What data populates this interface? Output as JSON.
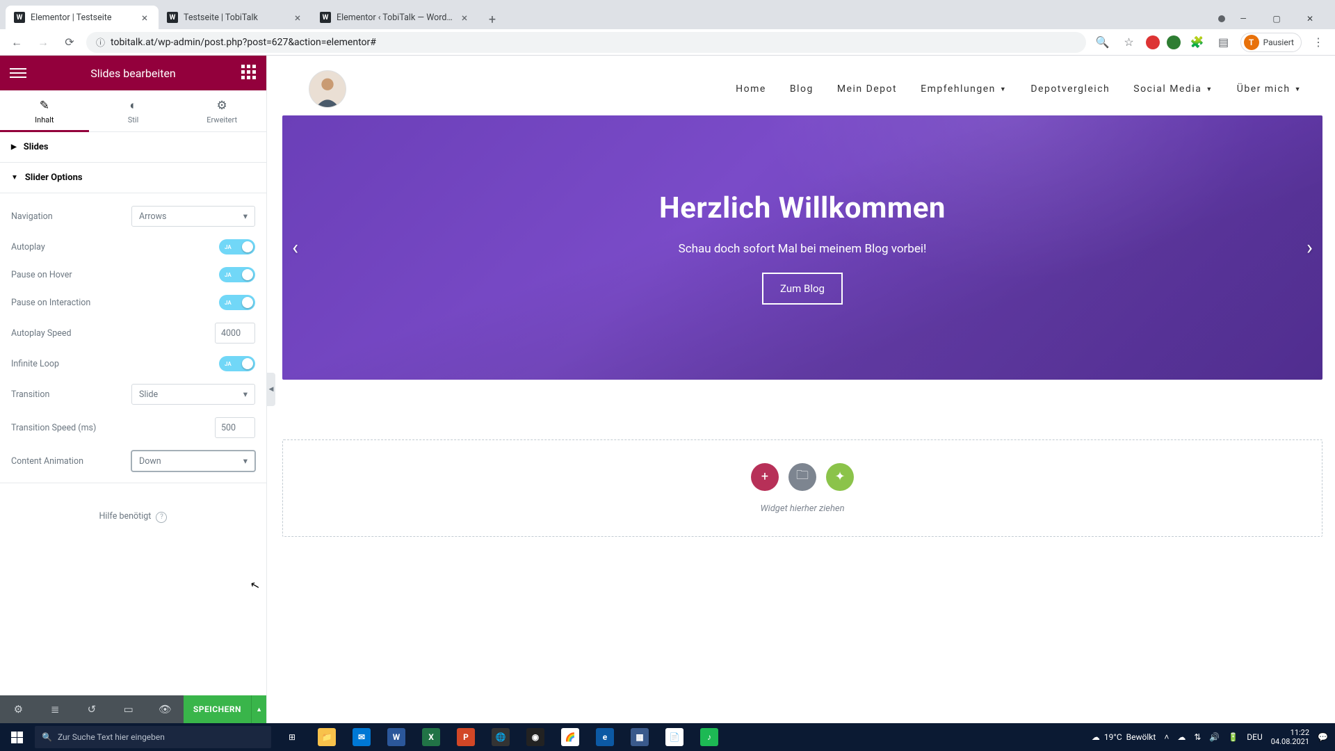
{
  "browser": {
    "tabs": [
      {
        "title": "Elementor | Testseite",
        "active": true
      },
      {
        "title": "Testseite | TobiTalk",
        "active": false
      },
      {
        "title": "Elementor ‹ TobiTalk — WordPre",
        "active": false
      }
    ],
    "url": "tobitalk.at/wp-admin/post.php?post=627&action=elementor#",
    "profile_label": "Pausiert",
    "profile_initial": "T"
  },
  "panel": {
    "title": "Slides bearbeiten",
    "tabs": {
      "content": "Inhalt",
      "style": "Stil",
      "advanced": "Erweitert"
    },
    "sections": {
      "slides_head": "Slides",
      "slider_options_head": "Slider Options"
    },
    "controls": {
      "navigation_label": "Navigation",
      "navigation_value": "Arrows",
      "autoplay_label": "Autoplay",
      "pause_hover_label": "Pause on Hover",
      "pause_interaction_label": "Pause on Interaction",
      "autoplay_speed_label": "Autoplay Speed",
      "autoplay_speed_value": "4000",
      "infinite_loop_label": "Infinite Loop",
      "transition_label": "Transition",
      "transition_value": "Slide",
      "transition_speed_label": "Transition Speed (ms)",
      "transition_speed_value": "500",
      "content_animation_label": "Content Animation",
      "content_animation_value": "Down",
      "toggle_on": "JA"
    },
    "help_label": "Hilfe benötigt",
    "save_label": "SPEICHERN"
  },
  "site": {
    "nav": {
      "home": "Home",
      "blog": "Blog",
      "depot": "Mein Depot",
      "empfehlungen": "Empfehlungen",
      "depotvergleich": "Depotvergleich",
      "social": "Social Media",
      "uber": "Über mich"
    },
    "hero": {
      "title": "Herzlich Willkommen",
      "subtitle": "Schau doch sofort Mal bei meinem Blog vorbei!",
      "button": "Zum Blog"
    },
    "dropzone_text": "Widget hierher ziehen"
  },
  "taskbar": {
    "search_placeholder": "Zur Suche Text hier eingeben",
    "weather_temp": "19°C",
    "weather_text": "Bewölkt",
    "lang": "DEU",
    "time": "11:22",
    "date": "04.08.2021"
  }
}
